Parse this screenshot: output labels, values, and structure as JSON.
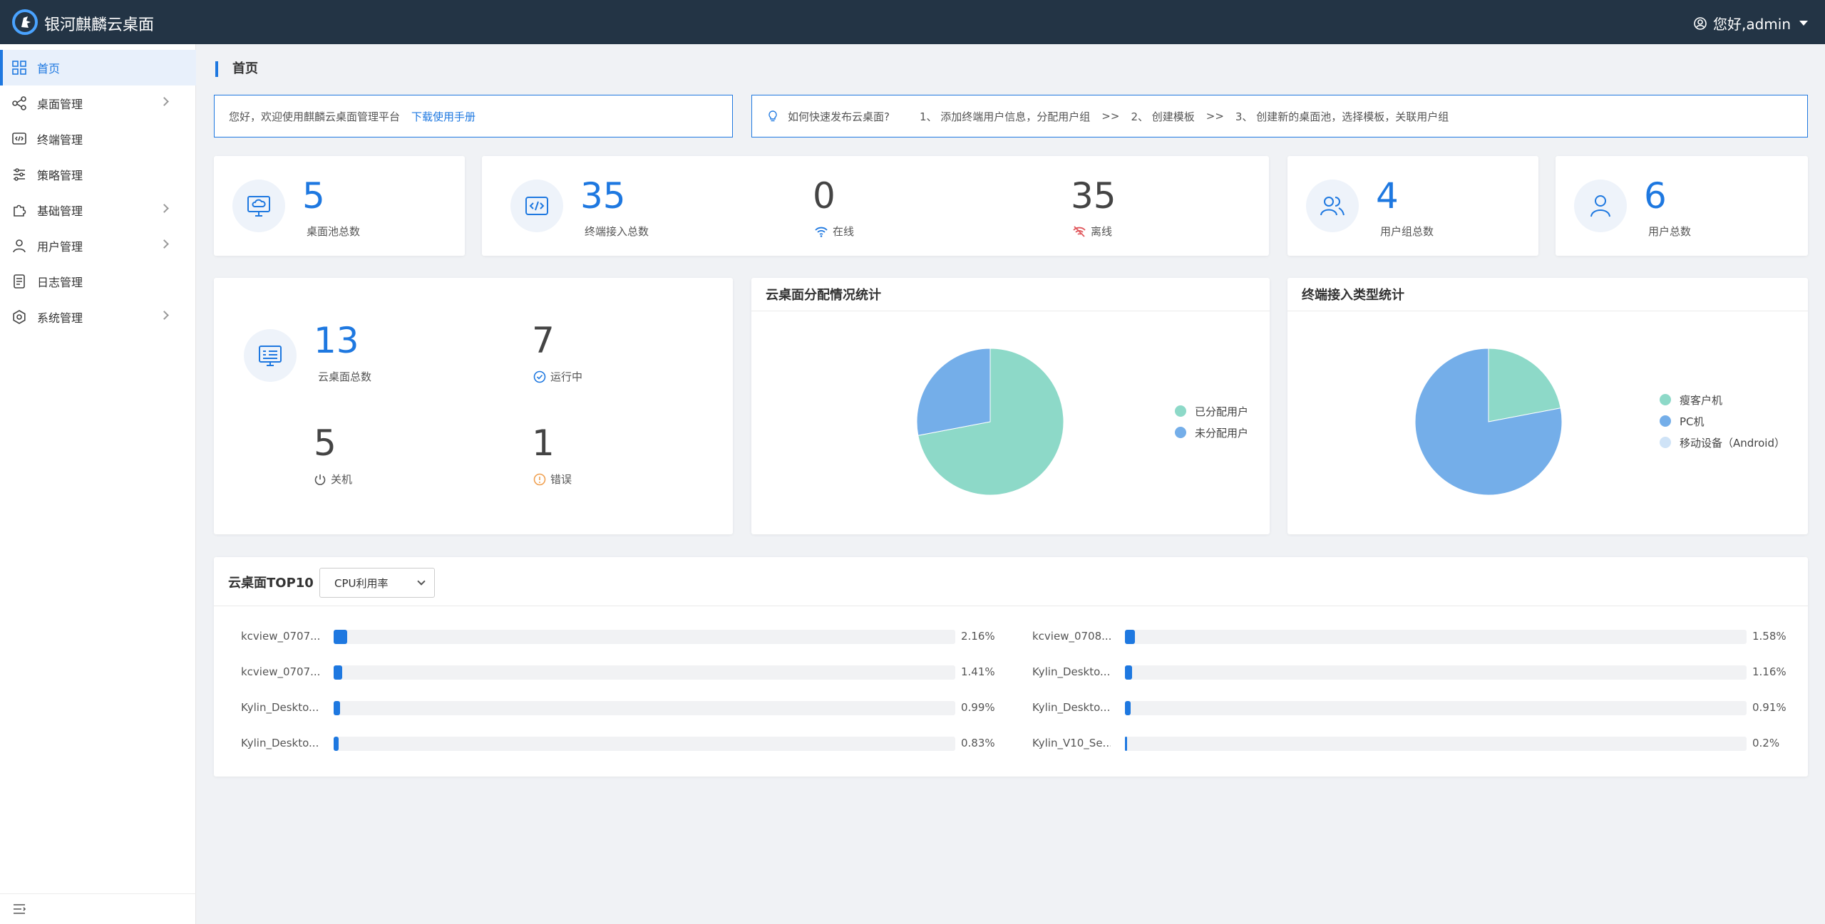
{
  "header": {
    "app_title": "银河麒麟云桌面",
    "user_greeting": "您好,admin"
  },
  "sidebar": {
    "items": [
      {
        "label": "首页",
        "icon": "grid-icon",
        "has_arrow": false,
        "active": true
      },
      {
        "label": "桌面管理",
        "icon": "share-nodes-icon",
        "has_arrow": true
      },
      {
        "label": "终端管理",
        "icon": "terminal-code-icon",
        "has_arrow": false
      },
      {
        "label": "策略管理",
        "icon": "sliders-icon",
        "has_arrow": false
      },
      {
        "label": "基础管理",
        "icon": "puzzle-icon",
        "has_arrow": true
      },
      {
        "label": "用户管理",
        "icon": "user-icon",
        "has_arrow": true
      },
      {
        "label": "日志管理",
        "icon": "document-icon",
        "has_arrow": false
      },
      {
        "label": "系统管理",
        "icon": "gear-icon",
        "has_arrow": true
      }
    ]
  },
  "page": {
    "title": "首页"
  },
  "notice": {
    "welcome": "您好，欢迎使用麒麟云桌面管理平台",
    "manual_link": "下载使用手册",
    "howto_title": "如何快速发布云桌面?",
    "steps": [
      "1、 添加终端用户信息，分配用户组",
      ">>",
      "2、 创建模板",
      ">>",
      "3、 创建新的桌面池，选择模板，关联用户组"
    ]
  },
  "stats": {
    "desktop_pools": {
      "value": "5",
      "label": "桌面池总数"
    },
    "terminals": {
      "value": "35",
      "label": "终端接入总数",
      "online_value": "0",
      "online_label": "在线",
      "offline_value": "35",
      "offline_label": "离线"
    },
    "user_groups": {
      "value": "4",
      "label": "用户组总数"
    },
    "users": {
      "value": "6",
      "label": "用户总数"
    }
  },
  "cloud_desktops": {
    "total_value": "13",
    "total_label": "云桌面总数",
    "running_value": "7",
    "running_label": "运行中",
    "shutdown_value": "5",
    "shutdown_label": "关机",
    "error_value": "1",
    "error_label": "错误"
  },
  "allocation_chart": {
    "title": "云桌面分配情况统计",
    "chart_data": {
      "type": "pie",
      "series": [
        {
          "name": "已分配用户",
          "value": 72,
          "color": "#8dd9c8"
        },
        {
          "name": "未分配用户",
          "value": 28,
          "color": "#74aee9"
        }
      ]
    }
  },
  "terminal_type_chart": {
    "title": "终端接入类型统计",
    "chart_data": {
      "type": "pie",
      "series": [
        {
          "name": "瘦客户机",
          "value": 22,
          "color": "#8dd9c8"
        },
        {
          "name": "PC机",
          "value": 78,
          "color": "#74aee9"
        },
        {
          "name": "移动设备（Android）",
          "value": 0,
          "color": "#cfe3f7"
        }
      ]
    }
  },
  "top10": {
    "title": "云桌面TOP10",
    "select_value": "CPU利用率",
    "left": [
      {
        "name": "kcview_0707...",
        "value": "2.16%",
        "pct": 2.16
      },
      {
        "name": "kcview_0707...",
        "value": "1.41%",
        "pct": 1.41
      },
      {
        "name": "Kylin_Deskto...",
        "value": "0.99%",
        "pct": 0.99
      },
      {
        "name": "Kylin_Deskto...",
        "value": "0.83%",
        "pct": 0.83
      }
    ],
    "right": [
      {
        "name": "kcview_0708...",
        "value": "1.58%",
        "pct": 1.58
      },
      {
        "name": "Kylin_Deskto...",
        "value": "1.16%",
        "pct": 1.16
      },
      {
        "name": "Kylin_Deskto...",
        "value": "0.91%",
        "pct": 0.91
      },
      {
        "name": "Kylin_V10_Se...",
        "value": "0.2%",
        "pct": 0.2
      }
    ]
  },
  "colors": {
    "accent": "#1e78e0",
    "header_bg": "#233445",
    "online": "#1e78e0",
    "offline": "#e0565b",
    "error": "#f0a050"
  }
}
